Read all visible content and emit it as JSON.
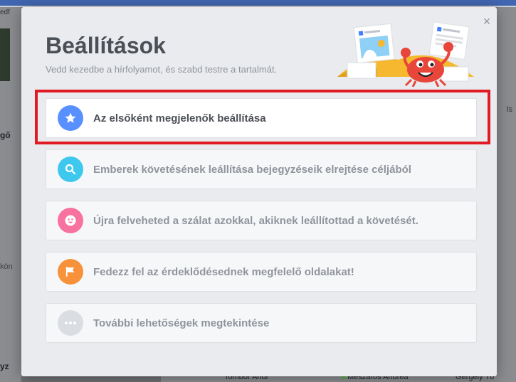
{
  "background": {
    "fragment_top_left": "edf",
    "fragment_go": "gő",
    "fragment_kon": "kön",
    "fragment_yz": "yz",
    "fragment_right": "ls",
    "bottom_names": [
      "Tombor Andi",
      "Mészáros Andrea",
      "Gergely Tö"
    ]
  },
  "dialog": {
    "title": "Beállítások",
    "subtitle": "Vedd kezedbe a hírfolyamot, és szabd testre a tartalmát.",
    "close_glyph": "×",
    "options": [
      {
        "label": "Az elsőként megjelenők beállítása",
        "icon": "star-icon",
        "color": "#5890ff"
      },
      {
        "label": "Emberek követésének leállítása bejegyzéseik elrejtése céljából",
        "icon": "search-icon",
        "color": "#3ec8ee"
      },
      {
        "label": "Újra felveheted a szálat azokkal, akiknek leállítottad a követését.",
        "icon": "smiley-icon",
        "color": "#f7729e"
      },
      {
        "label": "Fedezz fel az érdeklődésednek megfelelő oldalakat!",
        "icon": "flag-icon",
        "color": "#f7923b"
      },
      {
        "label": "További lehetőségek megtekintése",
        "icon": "more-icon",
        "color": "#dadde1"
      }
    ]
  },
  "colors": {
    "highlight": "#e01b24",
    "modal_bg": "#e9ebee"
  }
}
